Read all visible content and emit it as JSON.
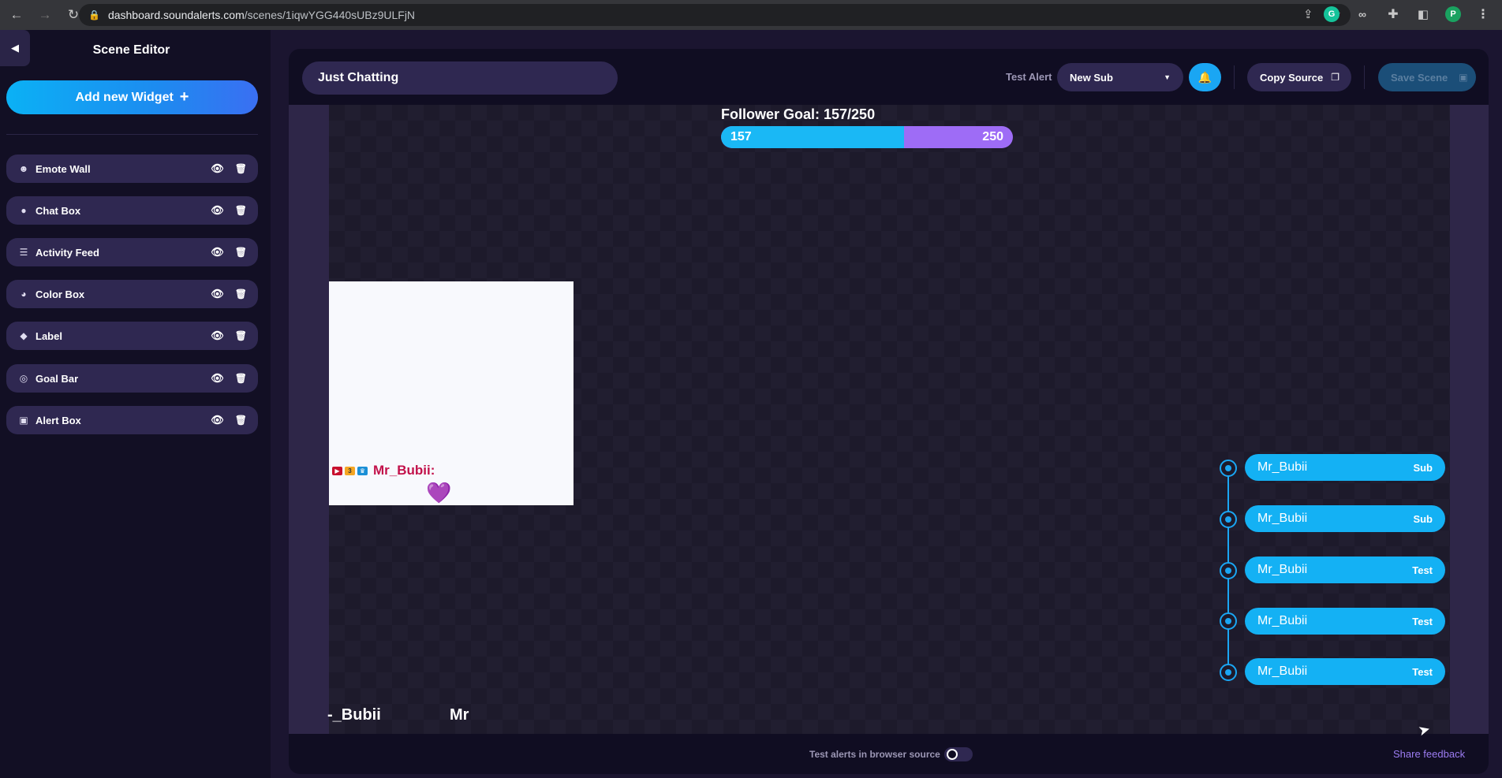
{
  "browser": {
    "url_host": "dashboard.soundalerts.com",
    "url_path": "/scenes/1iqwYGG440sUBz9ULFjN",
    "profile_initial": "P"
  },
  "sidebar": {
    "title": "Scene Editor",
    "add_widget_label": "Add new Widget",
    "add_widget_icon": "+",
    "items": [
      {
        "label": "Emote Wall",
        "icon": "☻"
      },
      {
        "label": "Chat Box",
        "icon": "●"
      },
      {
        "label": "Activity Feed",
        "icon": "☰"
      },
      {
        "label": "Color Box",
        "icon": "◕"
      },
      {
        "label": "Label",
        "icon": "◆"
      },
      {
        "label": "Goal Bar",
        "icon": "◎"
      },
      {
        "label": "Alert Box",
        "icon": "▣"
      }
    ]
  },
  "toolbar": {
    "scene_name": "Just Chatting",
    "test_alert_label": "Test Alert",
    "alert_select_value": "New Sub",
    "copy_source_label": "Copy Source",
    "save_scene_label": "Save Scene"
  },
  "goal": {
    "title": "Follower Goal: 157/250",
    "current": "157",
    "target": "250",
    "progress_fraction": 0.628
  },
  "chat": {
    "username": "Mr_Bubii:",
    "heart": "💜"
  },
  "activity_feed": [
    {
      "name": "Mr_Bubii",
      "type": "Sub"
    },
    {
      "name": "Mr_Bubii",
      "type": "Sub"
    },
    {
      "name": "Mr_Bubii",
      "type": "Test"
    },
    {
      "name": "Mr_Bubii",
      "type": "Test"
    },
    {
      "name": "Mr_Bubii",
      "type": "Test"
    }
  ],
  "ticker": {
    "text_a": "-_Bubii",
    "text_b": "Mr"
  },
  "footer": {
    "test_in_browser_label": "Test alerts in browser source",
    "share_feedback": "Share feedback"
  },
  "colors": {
    "accent_blue": "#14b1f4",
    "goal_purple": "#9e6cf6",
    "panel_bg": "#100d22",
    "sidebar_item_bg": "#2f2851"
  }
}
